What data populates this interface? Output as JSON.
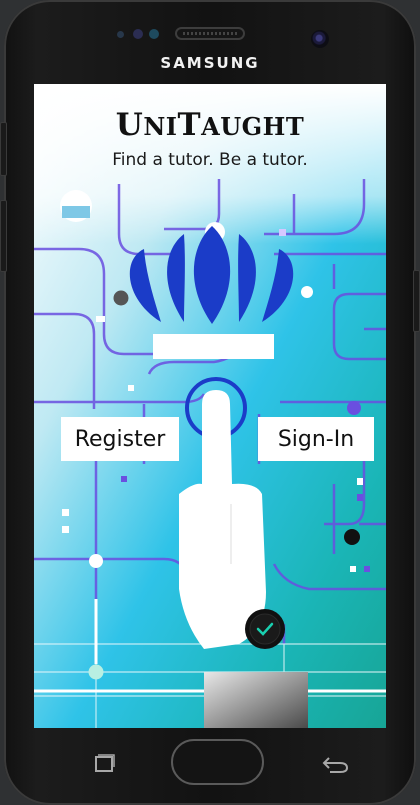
{
  "device": {
    "brand": "SAMSUNG"
  },
  "app": {
    "title_big_1": "U",
    "title_small_1": "NI",
    "title_big_2": "T",
    "title_small_2": "AUGHT",
    "tagline": "Find a tutor. Be a tutor.",
    "register_label": "Register",
    "signin_label": "Sign-In"
  },
  "colors": {
    "crown_blue": "#1b3cc8",
    "circuit_purple": "#6a4fe0",
    "bg_cyan": "#2fc3e8",
    "bg_teal": "#1aa89a"
  },
  "icons": [
    "crown-icon",
    "pointing-hand-icon",
    "checkmark-watch-icon",
    "recent-apps-icon",
    "home-button",
    "back-icon"
  ]
}
